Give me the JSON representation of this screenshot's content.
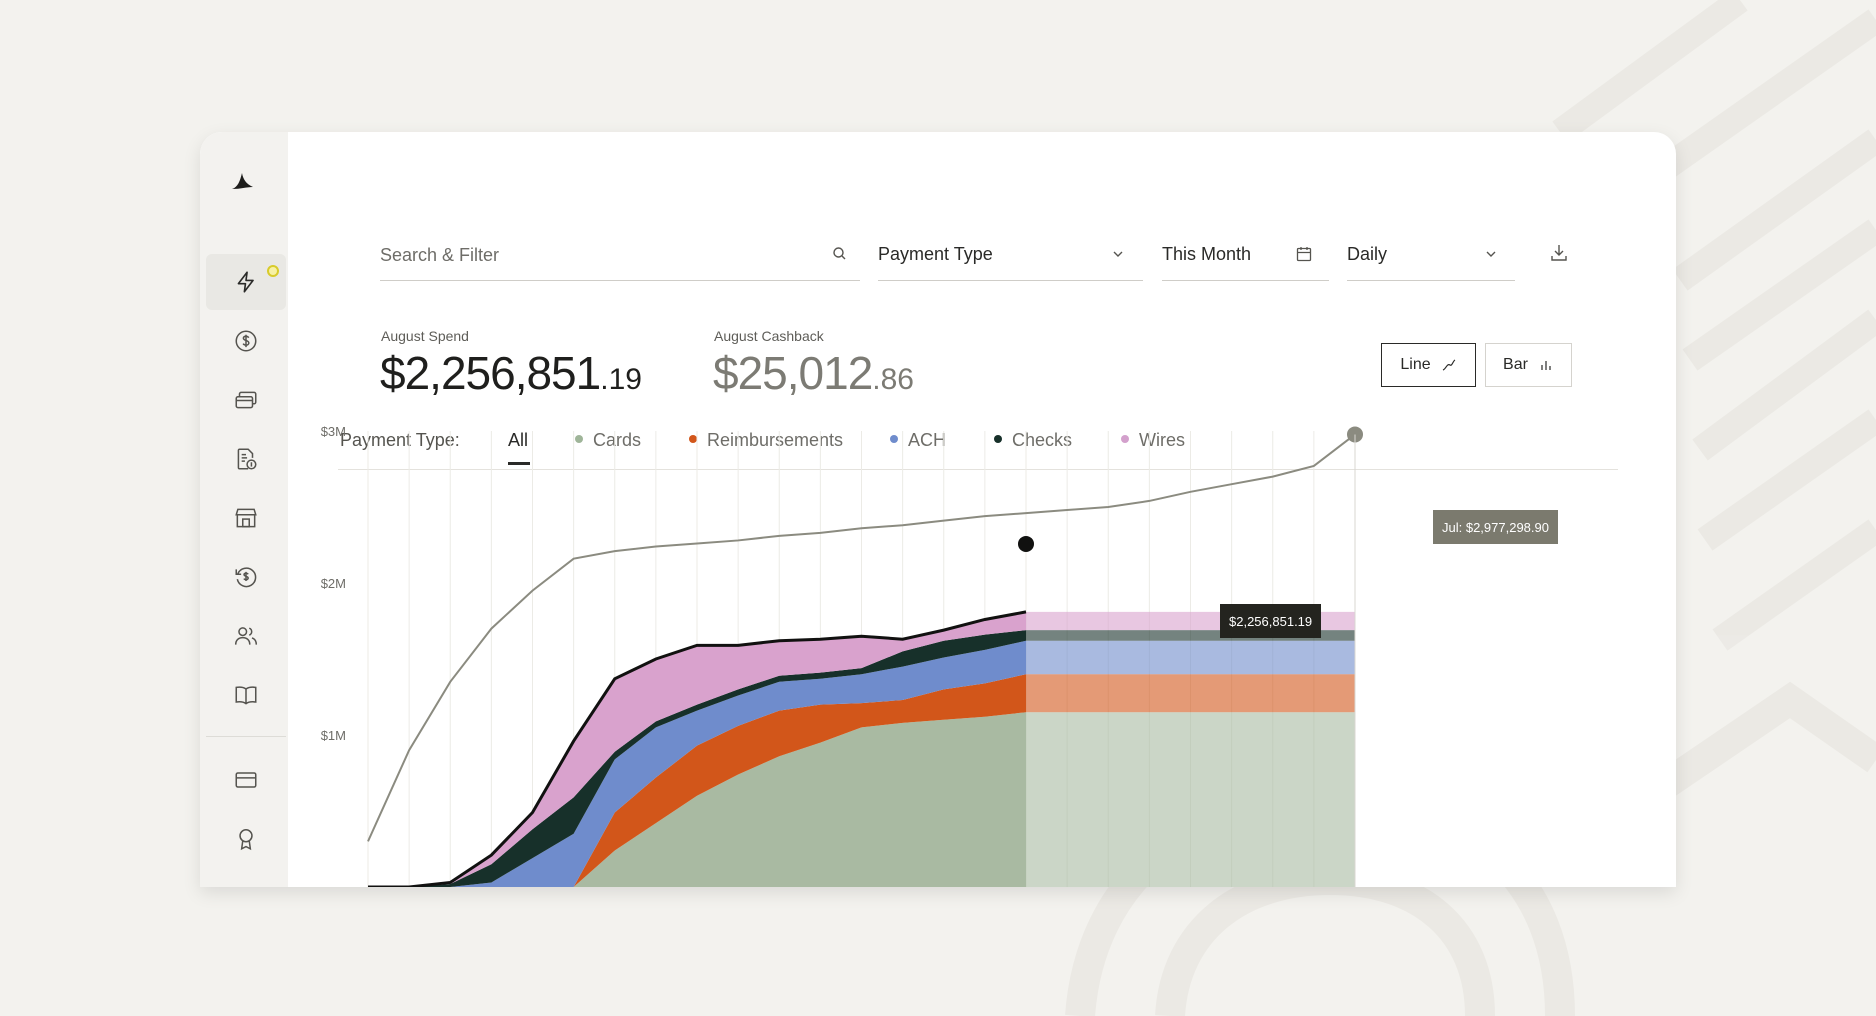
{
  "toolbar": {
    "search_placeholder": "Search & Filter",
    "payment_type_label": "Payment Type",
    "date_range_label": "This Month",
    "interval_label": "Daily"
  },
  "summary": {
    "spend_label": "August Spend",
    "spend_dollars": "$2,256,851",
    "spend_cents": ".19",
    "cashback_label": "August Cashback",
    "cashback_dollars": "$25,012",
    "cashback_cents": ".86"
  },
  "view_toggle": {
    "line_label": "Line",
    "bar_label": "Bar",
    "selected": "line"
  },
  "payment_tabs": {
    "label": "Payment Type:",
    "items": [
      {
        "label": "All",
        "color": null
      },
      {
        "label": "Cards",
        "color": "#9fb599"
      },
      {
        "label": "Reimbursements",
        "color": "#d2561a"
      },
      {
        "label": "ACH",
        "color": "#6f8ccc"
      },
      {
        "label": "Checks",
        "color": "#17302a"
      },
      {
        "label": "Wires",
        "color": "#d3a0cc"
      }
    ],
    "selected": "All"
  },
  "tooltips": {
    "current": "$2,256,851.19",
    "previous": "Jul: $2,977,298.90"
  },
  "colors": {
    "cards": "#a9baa2",
    "reimbursements": "#d2561a",
    "ach": "#6f8ccc",
    "checks": "#17302a",
    "wires": "#d9a2cd",
    "previous_line": "#8b8b80",
    "accent_dot": "#d8cb2b"
  },
  "icons": {
    "sidebar": [
      "bolt-icon",
      "dollar-circle-icon",
      "cards-stack-icon",
      "receipt-dollar-icon",
      "storefront-icon",
      "refund-icon",
      "users-icon",
      "book-icon",
      "credit-card-icon",
      "award-icon"
    ]
  },
  "chart_data": {
    "type": "area",
    "title": "",
    "xlabel": "",
    "ylabel": "",
    "y_tick_labels": [
      "$1M",
      "$2M",
      "$3M"
    ],
    "ylim": [
      0,
      3000000
    ],
    "x": [
      1,
      2,
      3,
      4,
      5,
      6,
      7,
      8,
      9,
      10,
      11,
      12,
      13,
      14,
      15,
      16,
      17,
      18,
      19,
      20,
      21,
      22,
      23,
      24,
      25
    ],
    "stacked": true,
    "current_period_days": 17,
    "series": [
      {
        "name": "Cards",
        "values": [
          0,
          0,
          0,
          0,
          0,
          0,
          240000,
          420000,
          600000,
          740000,
          860000,
          950000,
          1050000,
          1080000,
          1100000,
          1120000,
          1150000
        ]
      },
      {
        "name": "Reimbursements",
        "values": [
          0,
          0,
          0,
          0,
          0,
          0,
          250000,
          300000,
          330000,
          320000,
          300000,
          250000,
          160000,
          150000,
          200000,
          220000,
          250000
        ]
      },
      {
        "name": "ACH",
        "values": [
          0,
          0,
          0,
          30000,
          190000,
          350000,
          350000,
          330000,
          230000,
          200000,
          190000,
          170000,
          190000,
          220000,
          210000,
          220000,
          220000
        ]
      },
      {
        "name": "Checks",
        "values": [
          0,
          0,
          20000,
          120000,
          190000,
          240000,
          50000,
          40000,
          40000,
          40000,
          40000,
          40000,
          40000,
          100000,
          110000,
          100000,
          70000
        ]
      },
      {
        "name": "Wires",
        "values": [
          0,
          0,
          10000,
          60000,
          110000,
          370000,
          480000,
          410000,
          390000,
          290000,
          230000,
          220000,
          210000,
          80000,
          70000,
          100000,
          120000
        ]
      }
    ],
    "projection": {
      "from_day": 17,
      "to_day": 25,
      "values": {
        "Cards": 1150000,
        "Reimbursements": 250000,
        "ACH": 220000,
        "Checks": 70000,
        "Wires": 120000
      }
    },
    "previous_period": {
      "values": [
        300000,
        900000,
        1350000,
        1700000,
        1950000,
        2160000,
        2210000,
        2240000,
        2260000,
        2280000,
        2310000,
        2330000,
        2360000,
        2380000,
        2410000,
        2440000,
        2460000,
        2480000,
        2500000,
        2540000,
        2600000,
        2650000,
        2700000,
        2770000,
        2977298.9
      ]
    },
    "current_total": 2256851.19,
    "grid": "vertical"
  }
}
